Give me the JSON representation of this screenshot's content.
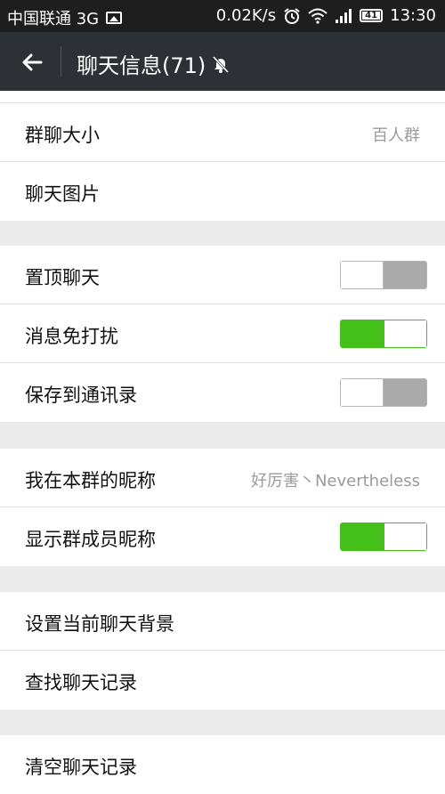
{
  "status_bar": {
    "carrier": "中国联通 3G",
    "speed": "0.02K/s",
    "battery": "41",
    "time": "13:30"
  },
  "header": {
    "title": "聊天信息(71)",
    "back_icon": "back-arrow-icon",
    "mute_icon": "bell-off-icon"
  },
  "groups": {
    "g1": {
      "group_size_label": "群聊大小",
      "group_size_value": "百人群",
      "chat_images_label": "聊天图片"
    },
    "g2": {
      "pin_chat_label": "置顶聊天",
      "pin_chat_on": false,
      "mute_notifications_label": "消息免打扰",
      "mute_notifications_on": true,
      "save_to_contacts_label": "保存到通讯录",
      "save_to_contacts_on": false
    },
    "g3": {
      "my_nickname_label": "我在本群的昵称",
      "my_nickname_value": "好厉害丶Nevertheless",
      "show_member_nicknames_label": "显示群成员昵称",
      "show_member_nicknames_on": true
    },
    "g4": {
      "set_background_label": "设置当前聊天背景",
      "search_history_label": "查找聊天记录"
    },
    "g5": {
      "clear_history_label": "清空聊天记录"
    }
  },
  "colors": {
    "header_bg": "#2d3034",
    "toggle_on": "#45c01a",
    "toggle_off": "#aaaaaa"
  }
}
